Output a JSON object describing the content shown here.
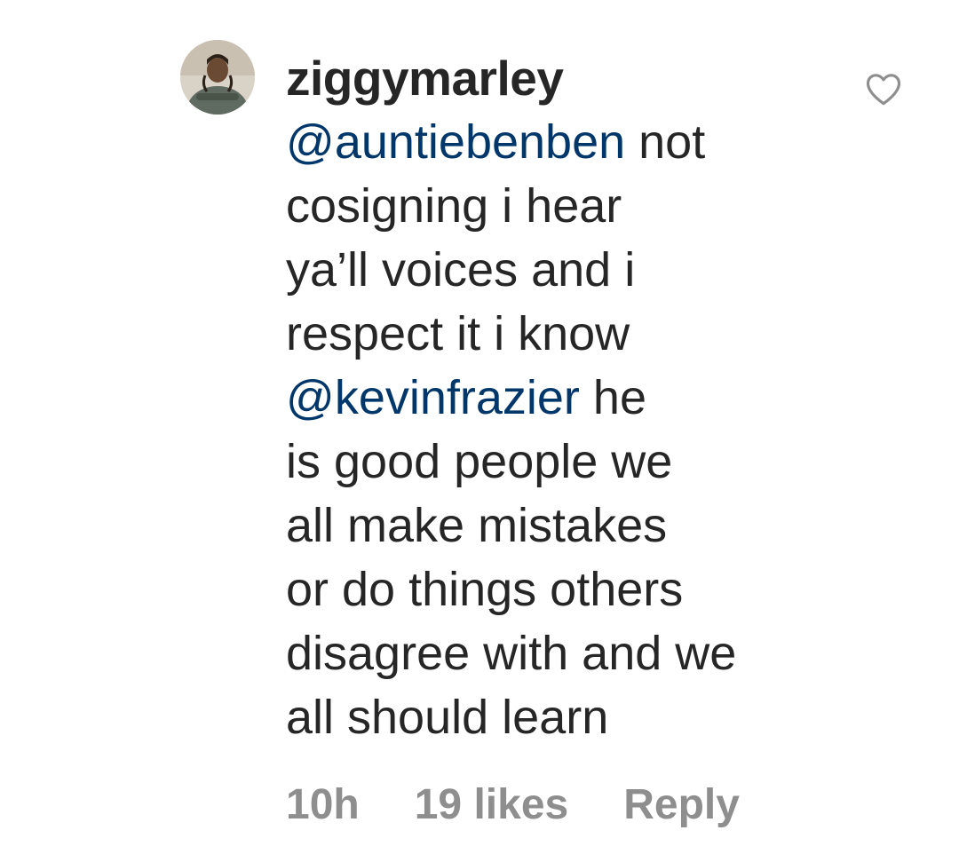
{
  "comment": {
    "username": "ziggymarley",
    "avatar_icon": "profile-photo",
    "lines": [
      {
        "mention": "@auntiebenben",
        "rest": " not"
      },
      {
        "mention": "",
        "rest": "cosigning i hear"
      },
      {
        "mention": "",
        "rest": "ya’ll voices and i"
      },
      {
        "mention": "",
        "rest": "respect it i know"
      },
      {
        "mention": "@kevinfrazier",
        "rest": " he"
      },
      {
        "mention": "",
        "rest": "is good people we"
      },
      {
        "mention": "",
        "rest": "all make mistakes"
      },
      {
        "mention": "",
        "rest": "or do things others"
      },
      {
        "mention": "",
        "rest": "disagree with and we"
      },
      {
        "mention": "",
        "rest": "all should learn"
      }
    ],
    "time": "10h",
    "likes": "19 likes",
    "reply_label": "Reply",
    "like_icon": "heart-outline-icon"
  },
  "colors": {
    "text": "#262626",
    "mention": "#00376b",
    "meta": "#8e8e8e"
  }
}
